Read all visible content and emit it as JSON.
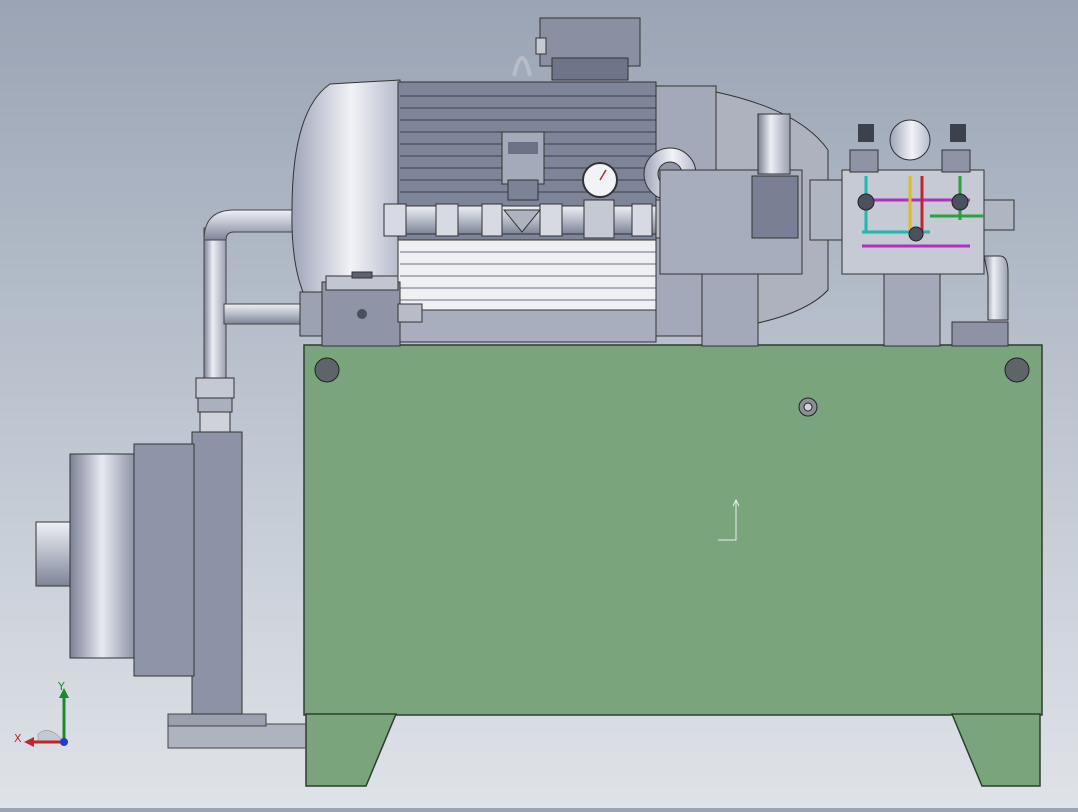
{
  "window": {
    "type": "CAD 3D model viewport"
  },
  "model": {
    "description_colors": {
      "tank": "#7aa57c",
      "tank_edge": "#3f5a41",
      "motor_gray": "#8f96a8",
      "steel": "#c9ccd6",
      "pipe_cyan": "#1fb8b0",
      "pipe_magenta": "#b030c0",
      "pipe_green": "#2aa040",
      "pipe_yellow": "#d8c020",
      "pipe_red": "#c0262e"
    }
  },
  "triad": {
    "y_label": "Y",
    "x_label": "X",
    "y_color": "#1b8a2a",
    "x_color": "#c0262e",
    "z_color": "#1e3fd0"
  }
}
